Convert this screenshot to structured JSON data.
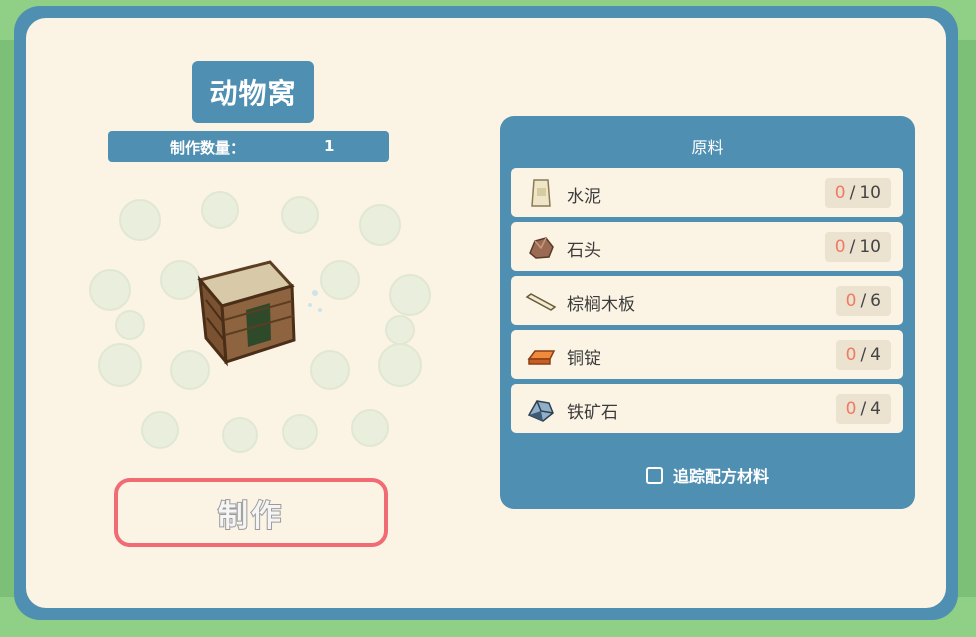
{
  "recipe": {
    "title": "动物窝",
    "quantity_label": "制作数量：",
    "quantity_value": "1",
    "item_icon": "animal-den-icon"
  },
  "craft_button": {
    "label": "制作",
    "border_color": "#f06b73"
  },
  "materials": {
    "header": "原料",
    "items": [
      {
        "name": "水泥",
        "have": "0",
        "need": "10",
        "icon": "cement-bag-icon"
      },
      {
        "name": "石头",
        "have": "0",
        "need": "10",
        "icon": "stone-icon"
      },
      {
        "name": "棕榈木板",
        "have": "0",
        "need": "6",
        "icon": "palm-plank-icon"
      },
      {
        "name": "铜锭",
        "have": "0",
        "need": "4",
        "icon": "copper-ingot-icon"
      },
      {
        "name": "铁矿石",
        "have": "0",
        "need": "4",
        "icon": "iron-ore-icon"
      }
    ],
    "count_separator": "/",
    "track_label": "追踪配方材料"
  },
  "colors": {
    "panel_blue": "#4f8fb1",
    "panel_cream": "#fbf4e5",
    "count_have": "#f07a64",
    "background_green": "#7cbf76"
  }
}
